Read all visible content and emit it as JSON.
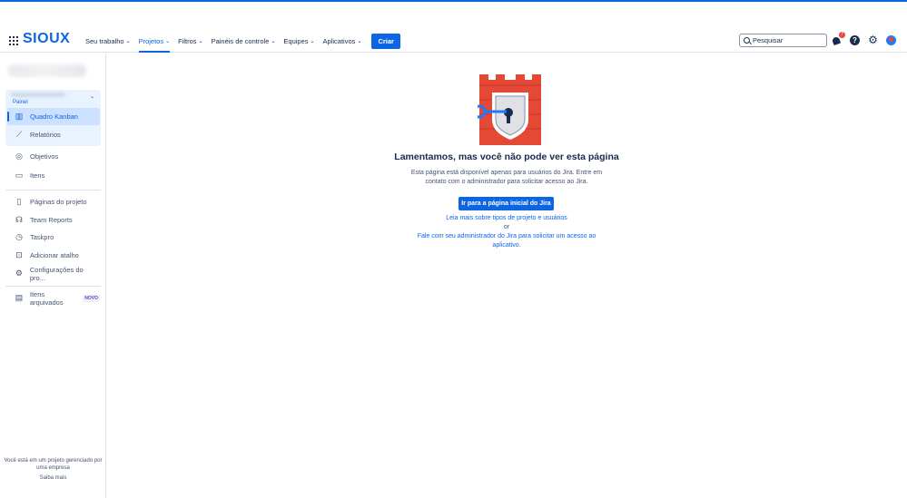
{
  "brand": {
    "logo_text": "SIOUX",
    "accent": "#0c66e4"
  },
  "nav": {
    "items": [
      {
        "label": "Seu trabalho",
        "active": false
      },
      {
        "label": "Projetos",
        "active": true
      },
      {
        "label": "Filtros",
        "active": false
      },
      {
        "label": "Painéis de controle",
        "active": false
      },
      {
        "label": "Equipes",
        "active": false
      },
      {
        "label": "Aplicativos",
        "active": false
      }
    ],
    "create_label": "Criar"
  },
  "search": {
    "placeholder": "Pesquisar"
  },
  "notifications": {
    "count": "7",
    "badge_color": "#e34935"
  },
  "icons": [
    "apps-grid-icon",
    "search-icon",
    "bell-icon",
    "help-icon",
    "gear-icon",
    "avatar"
  ],
  "sidebar": {
    "panel_label": "Painel",
    "board_items": [
      {
        "label": "Quadro Kanban",
        "icon": "board-icon",
        "active": true
      },
      {
        "label": "Relatórios",
        "icon": "chart-line-icon",
        "active": false
      }
    ],
    "items": [
      {
        "label": "Objetivos",
        "icon": "target-icon"
      },
      {
        "label": "Itens",
        "icon": "issues-icon"
      },
      {
        "label": "Páginas do projeto",
        "icon": "page-icon"
      },
      {
        "label": "Team Reports",
        "icon": "team-reports-icon"
      },
      {
        "label": "Taskpro",
        "icon": "taskpro-icon"
      },
      {
        "label": "Adicionar atalho",
        "icon": "add-shortcut-icon"
      },
      {
        "label": "Configurações do pro...",
        "icon": "gear-icon"
      },
      {
        "label": "Itens arquivados",
        "icon": "archive-icon",
        "badge": "NOVO"
      }
    ],
    "footer_text": "Você está em um projeto gerenciado por uma empresa",
    "footer_link": "Saiba mais"
  },
  "main": {
    "title": "Lamentamos, mas você não pode ver esta página",
    "description": "Esta página está disponível apenas para usuários do Jira. Entre em contato com o administrador para solicitar acesso ao Jira.",
    "button_label": "Ir para a página inicial do Jira",
    "link_learn": "Leia mais sobre tipos de projeto e usuários",
    "or_text": "or",
    "link_contact": "Fale com seu administrador do Jira para solicitar um acesso ao aplicativo.",
    "illustration_colors": {
      "castle": "#e34935",
      "key": "#1d7afc"
    }
  }
}
